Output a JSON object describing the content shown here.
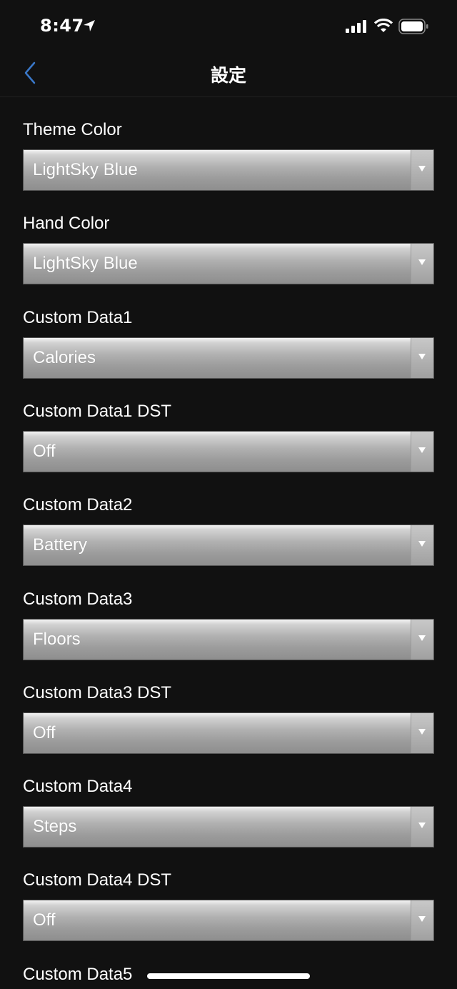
{
  "status_bar": {
    "time": "8:47",
    "icons": [
      "location-arrow-icon",
      "signal-icon",
      "wifi-icon",
      "battery-icon"
    ]
  },
  "nav": {
    "title": "設定",
    "back_icon": "chevron-left-icon",
    "accent_color": "#3a78c9"
  },
  "settings": [
    {
      "label": "Theme Color",
      "value": "LightSky Blue"
    },
    {
      "label": "Hand Color",
      "value": "LightSky Blue"
    },
    {
      "label": "Custom Data1",
      "value": "Calories"
    },
    {
      "label": "Custom Data1 DST",
      "value": "Off"
    },
    {
      "label": "Custom Data2",
      "value": "Battery"
    },
    {
      "label": "Custom Data3",
      "value": "Floors"
    },
    {
      "label": "Custom Data3 DST",
      "value": "Off"
    },
    {
      "label": "Custom Data4",
      "value": "Steps"
    },
    {
      "label": "Custom Data4 DST",
      "value": "Off"
    },
    {
      "label": "Custom Data5",
      "value": null
    }
  ]
}
